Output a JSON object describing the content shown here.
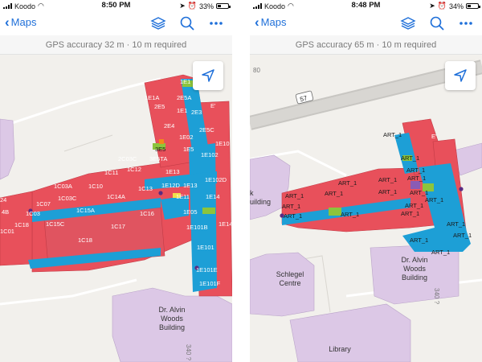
{
  "left": {
    "status": {
      "carrier": "Koodo",
      "time": "8:50 PM",
      "battery": "33%",
      "battery_level": 0.33
    },
    "nav": {
      "back_label": "Maps"
    },
    "gps": {
      "text": "GPS accuracy 32 m · 10 m required"
    },
    "rooms": [
      "1E1",
      "1E1A",
      "2E5A",
      "2E5",
      "1E1",
      "2E3",
      "2E4",
      "2E5C",
      "1E02",
      "1E10",
      "1E5",
      "2C03C",
      "1E102",
      "3E5TA",
      "3E5",
      "1E11",
      "1E12",
      "1E13",
      "1E102D",
      "1C03A",
      "1C10",
      "1E12D",
      "1E13",
      "1C03C",
      "1C14A",
      "1C13",
      "1E11",
      "1E14",
      "1C07",
      "1C03",
      "1C15A",
      "1C16",
      "1E05",
      "1E14",
      "1C15C",
      "1C17",
      "1C18",
      "1E101B",
      "1C01",
      "1C18",
      "1E101",
      "1E101E",
      "1E101F",
      "1C01",
      "E'"
    ],
    "buildings": {
      "main": [
        "Dr. Alvin",
        "Woods",
        "Building"
      ]
    }
  },
  "right": {
    "status": {
      "carrier": "Koodo",
      "time": "8:48 PM",
      "battery": "34%",
      "battery_level": 0.34
    },
    "nav": {
      "back_label": "Maps"
    },
    "gps": {
      "text": "GPS accuracy 65 m · 10 m required"
    },
    "road": {
      "number": "57",
      "number2": "80"
    },
    "rooms": [
      "ART_1",
      "ART_1",
      "ART_1",
      "ART_1",
      "ART_1",
      "ART_1",
      "ART_1",
      "ART_1",
      "ART_1",
      "ART_1",
      "ART_1",
      "ART_1",
      "ART_1",
      "ART_1",
      "ART_1",
      "ART_1",
      "ART_1",
      "ART_1",
      "ART_1",
      "ART_1",
      "E'"
    ],
    "buildings": {
      "schlegel": [
        "Schlegel",
        "Centre"
      ],
      "woods": [
        "Dr. Alvin",
        "Woods",
        "Building"
      ],
      "library": "Library",
      "building_left": [
        "k",
        "uilding"
      ],
      "street": "340 ?"
    }
  },
  "colors": {
    "accent": "#1e6fd9",
    "room_red": "#e8505b",
    "corridor_blue": "#1d9fd6",
    "building_lilac": "#dcc8e6",
    "green": "#8cc43c",
    "purple": "#8a5bb5"
  }
}
